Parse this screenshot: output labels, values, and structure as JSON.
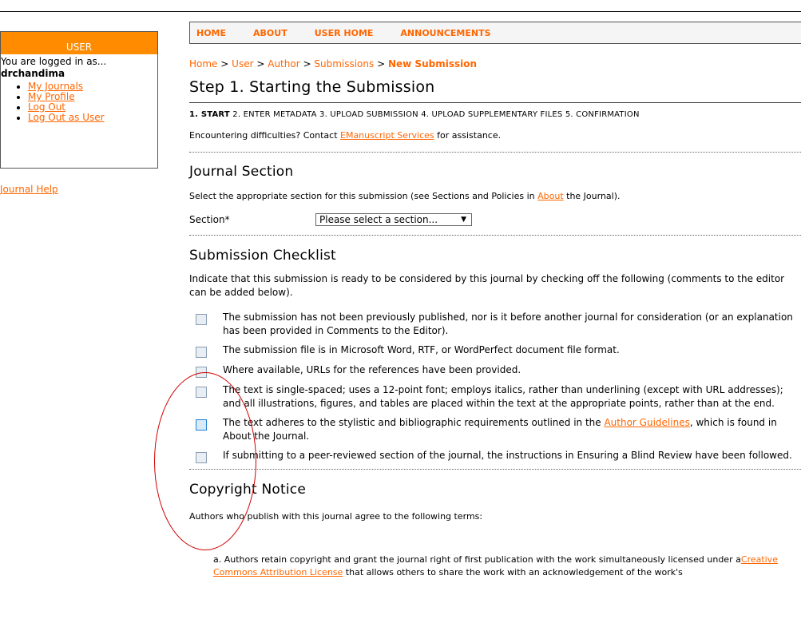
{
  "sidebar": {
    "header": "USER",
    "logged_in_as": "You are logged in as...",
    "username": "drchandima",
    "links": [
      "My Journals",
      "My Profile",
      "Log Out",
      "Log Out as User"
    ],
    "help": "Journal Help"
  },
  "nav": {
    "items": [
      "HOME",
      "ABOUT",
      "USER HOME",
      "ANNOUNCEMENTS"
    ]
  },
  "breadcrumb": {
    "items": [
      "Home",
      "User",
      "Author",
      "Submissions"
    ],
    "current": "New Submission",
    "separator": ">"
  },
  "page": {
    "title": "Step 1. Starting the Submission",
    "steps": {
      "current": "1. START",
      "rest": "2. ENTER METADATA  3. UPLOAD SUBMISSION  4. UPLOAD SUPPLEMENTARY FILES  5. CONFIRMATION"
    },
    "difficulty": {
      "before": "Encountering difficulties? Contact ",
      "link": "EManuscript Services",
      "after": " for assistance."
    }
  },
  "journal_section": {
    "heading": "Journal Section",
    "intro_before": "Select the appropriate section for this submission (see Sections and Policies in ",
    "intro_link": "About",
    "intro_after": " the Journal).",
    "label": "Section*",
    "select_value": "Please select a section..."
  },
  "checklist": {
    "heading": "Submission Checklist",
    "intro": "Indicate that this submission is ready to be considered by this journal by checking off the following (comments to the editor can be added below).",
    "items": [
      "The submission has not been previously published, nor is it before another journal for consideration (or an explanation has been provided in Comments to the Editor).",
      "The submission file is in Microsoft Word, RTF, or WordPerfect document file format.",
      "Where available, URLs for the references have been provided.",
      "The text is single-spaced; uses a 12-point font; employs italics, rather than underlining (except with URL addresses); and all illustrations, figures, and tables are placed within the text at the appropriate points, rather than at the end.",
      "The text adheres to the stylistic and bibliographic requirements outlined in the ",
      "If submitting to a peer-reviewed section of the journal, the instructions in Ensuring a Blind Review have been followed."
    ],
    "item5_link": "Author Guidelines",
    "item5_after": ", which is found in About the Journal."
  },
  "copyright": {
    "heading": "Copyright Notice",
    "intro": "Authors who publish with this journal agree to the following terms:",
    "term_a_before": "a.  Authors retain copyright and grant the journal right of first publication with the work simultaneously licensed under a",
    "term_a_link": "Creative Commons Attribution License",
    "term_a_after": " that allows others to share the work with an acknowledgement of the work's"
  },
  "colors": {
    "accent": "#ff6600",
    "header_bg": "#ff8c00",
    "annotation": "#d00000"
  }
}
